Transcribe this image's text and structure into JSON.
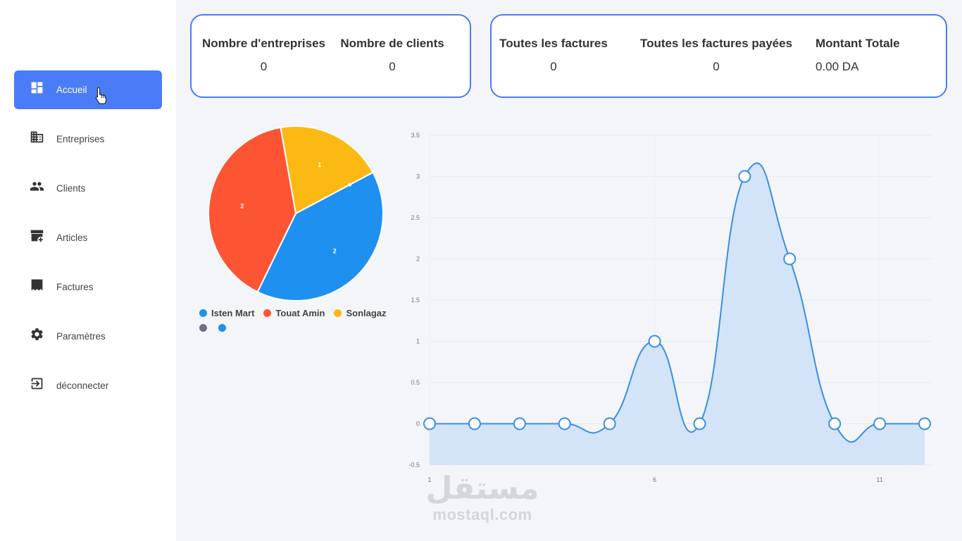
{
  "sidebar": {
    "items": [
      {
        "label": "Accueil",
        "icon": "dashboard-icon",
        "active": true
      },
      {
        "label": "Entreprises",
        "icon": "building-icon",
        "active": false
      },
      {
        "label": "Clients",
        "icon": "people-icon",
        "active": false
      },
      {
        "label": "Articles",
        "icon": "archive-add-icon",
        "active": false
      },
      {
        "label": "Factures",
        "icon": "receipt-icon",
        "active": false
      },
      {
        "label": "Paramètres",
        "icon": "gear-icon",
        "active": false
      },
      {
        "label": "déconnecter",
        "icon": "logout-icon",
        "active": false
      }
    ],
    "accent": "#4a7cf7"
  },
  "stats": {
    "companies": {
      "label": "Nombre d'entreprises",
      "value": "0"
    },
    "clients": {
      "label": "Nombre de clients",
      "value": "0"
    },
    "invoices": {
      "label": "Toutes les factures",
      "value": "0"
    },
    "paid_invoices": {
      "label": "Toutes les factures payées",
      "value": "0"
    },
    "total_amount": {
      "label": "Montant Totale",
      "value": "0.00 DA"
    }
  },
  "watermark": {
    "arabic": "مستقل",
    "latin": "mostaql.com"
  },
  "chart_data": [
    {
      "type": "pie",
      "slices": [
        {
          "name": "Isten Mart",
          "value": 2,
          "color": "#1e90f0"
        },
        {
          "name": "Touat Amin",
          "value": 2,
          "color": "#fd5433"
        },
        {
          "name": "Sonlagaz",
          "value": 1,
          "color": "#fdb913"
        },
        {
          "name": "",
          "value": 0,
          "color": "#6b7280"
        },
        {
          "name": "",
          "value": 0,
          "color": "#1e90f0"
        }
      ],
      "legend_position": "bottom"
    },
    {
      "type": "area",
      "x": [
        1,
        2,
        3,
        4,
        5,
        6,
        7,
        8,
        9,
        10,
        11,
        12
      ],
      "values": [
        0,
        0,
        0,
        0,
        0,
        1,
        0,
        3,
        2,
        0,
        0,
        0
      ],
      "xticks": [
        "1",
        "6",
        "11"
      ],
      "yticks": [
        "-0.5",
        "0",
        "0.5",
        "1",
        "1.5",
        "2",
        "2.5",
        "3",
        "3.5"
      ],
      "ylim": [
        -0.5,
        3.5
      ],
      "line_color": "#3b8de3",
      "fill_color": "#d3e4f8",
      "grid": true
    }
  ]
}
